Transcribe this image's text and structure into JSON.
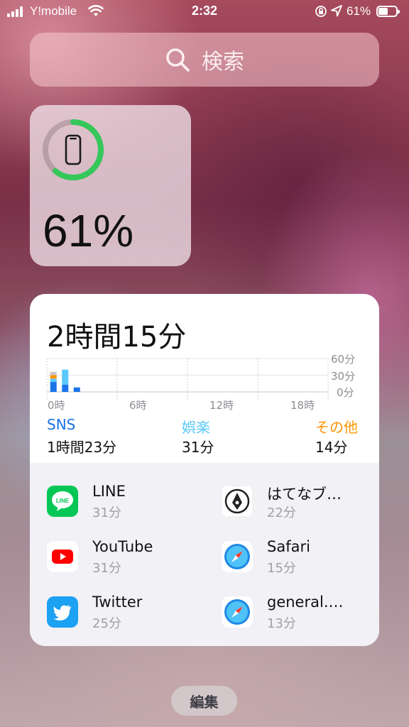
{
  "status_bar": {
    "carrier": "Y!mobile",
    "time": "2:32",
    "battery_percent": "61%",
    "battery_level": 0.61
  },
  "search": {
    "placeholder": "検索",
    "icon": "search-icon"
  },
  "battery_widget": {
    "percent": "61%",
    "level": 0.61,
    "device_icon": "iphone-icon",
    "ring_color": "#34c759"
  },
  "screen_time": {
    "total": "2時間15分",
    "chart_data": {
      "type": "bar",
      "x_ticks": [
        "0時",
        "6時",
        "12時",
        "18時"
      ],
      "y_ticks": [
        "60分",
        "30分",
        "0分"
      ],
      "ylim": [
        0,
        60
      ],
      "series": [
        {
          "name": "SNS",
          "color": "#1a73e8",
          "values": [
            18,
            13,
            8
          ]
        },
        {
          "name": "娯楽",
          "color": "#5ac8fa",
          "values": [
            6,
            27,
            0
          ]
        },
        {
          "name": "その他",
          "color": "#ff9500",
          "values": [
            6,
            0,
            0
          ]
        }
      ],
      "remaining_color": "#c7c7cc",
      "remaining_values": [
        6,
        0,
        0
      ]
    },
    "categories": [
      {
        "label": "SNS",
        "value": "1時間23分",
        "color": "#1a73e8"
      },
      {
        "label": "娯楽",
        "value": "31分",
        "color": "#5ac8fa"
      },
      {
        "label": "その他",
        "value": "14分",
        "color": "#ff9500"
      }
    ],
    "apps": [
      {
        "name": "LINE",
        "duration": "31分",
        "icon": "line-icon"
      },
      {
        "name": "はてなブ…",
        "duration": "22分",
        "icon": "hatena-blog-icon"
      },
      {
        "name": "YouTube",
        "duration": "31分",
        "icon": "youtube-icon"
      },
      {
        "name": "Safari",
        "duration": "15分",
        "icon": "safari-icon"
      },
      {
        "name": "Twitter",
        "duration": "25分",
        "icon": "twitter-icon"
      },
      {
        "name": "general.…",
        "duration": "13分",
        "icon": "safari-icon"
      }
    ]
  },
  "edit_button": "編集"
}
